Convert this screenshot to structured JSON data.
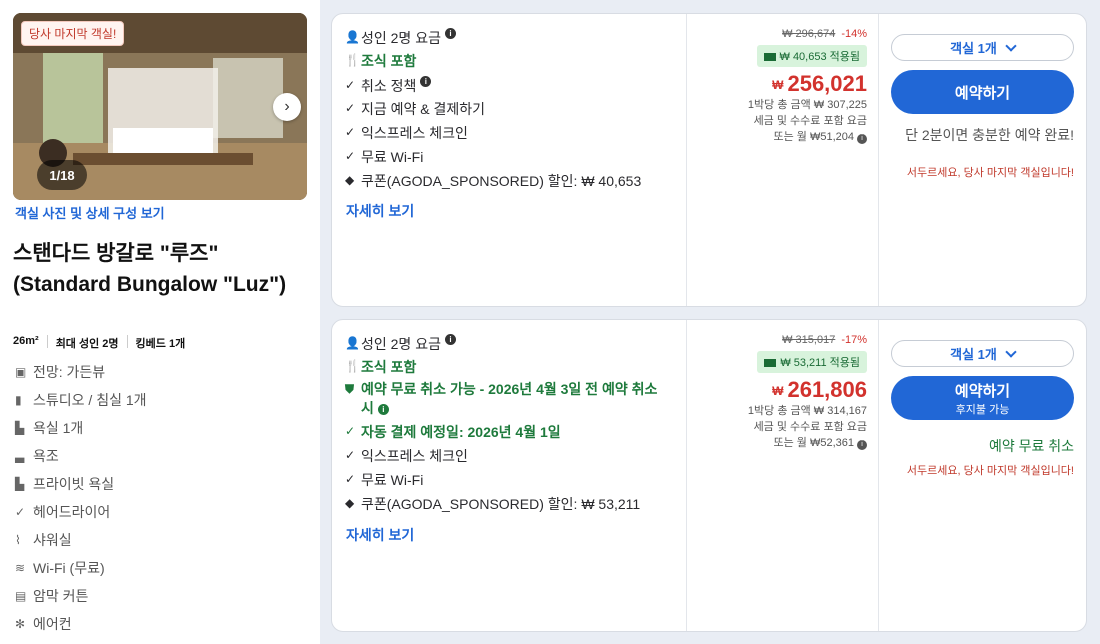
{
  "room": {
    "last_room_tag": "당사 마지막 객실!",
    "photo_counter": "1/18",
    "photos_link": "객실 사진 및 상세 구성 보기",
    "title": "스탠다드 방갈로 \"루즈\" (Standard Bungalow \"Luz\")",
    "specs": [
      "26m²",
      "최대 성인 2명",
      "킹베드 1개"
    ],
    "amenities": [
      {
        "icon": "view-icon",
        "label": "전망: 가든뷰"
      },
      {
        "icon": "studio-icon",
        "label": "스튜디오 / 침실 1개"
      },
      {
        "icon": "bathroom-icon",
        "label": "욕실 1개"
      },
      {
        "icon": "bathtub-icon",
        "label": "욕조"
      },
      {
        "icon": "private-bath-icon",
        "label": "프라이빗 욕실"
      },
      {
        "icon": "check-icon",
        "label": "헤어드라이어"
      },
      {
        "icon": "shower-icon",
        "label": "샤워실"
      },
      {
        "icon": "wifi-icon",
        "label": "Wi-Fi (무료)"
      },
      {
        "icon": "curtain-icon",
        "label": "암막 커튼"
      },
      {
        "icon": "aircon-icon",
        "label": "에어컨"
      }
    ]
  },
  "offers": [
    {
      "guests": "성인 2명 요금",
      "features": [
        {
          "icon": "person-icon",
          "text": "성인 2명 요금",
          "green": false,
          "info": true
        },
        {
          "icon": "breakfast-icon",
          "text": "조식 포함",
          "green": true,
          "info": false
        },
        {
          "icon": "check-icon",
          "text": "취소 정책",
          "green": false,
          "info": true
        },
        {
          "icon": "check-icon",
          "text": "지금 예약 & 결제하기",
          "green": false,
          "info": false
        },
        {
          "icon": "check-icon",
          "text": "익스프레스 체크인",
          "green": false,
          "info": false
        },
        {
          "icon": "check-icon",
          "text": "무료 Wi-Fi",
          "green": false,
          "info": false
        },
        {
          "icon": "coupon-icon",
          "text": "쿠폰(AGODA_SPONSORED) 할인: ₩ 40,653",
          "green": false,
          "info": false
        }
      ],
      "details_link": "자세히 보기",
      "original_price": "₩ 296,674",
      "discount": "-14%",
      "savings": "₩ 40,653 적용됨",
      "currency": "₩",
      "price": "256,021",
      "notes": [
        "1박당 총 금액 ₩ 307,225",
        "세금 및 수수료 포함 요금",
        "또는 월 ₩51,204"
      ],
      "qty": "객실 1개",
      "book_label": "예약하기",
      "book_sub": "",
      "urgency": "단 2분이면 충분한 예약 완료!",
      "free_cancel": "",
      "hurry": "서두르세요, 당사 마지막 객실입니다!"
    },
    {
      "guests": "성인 2명 요금",
      "features": [
        {
          "icon": "person-icon",
          "text": "성인 2명 요금",
          "green": false,
          "info": true
        },
        {
          "icon": "breakfast-icon",
          "text": "조식 포함",
          "green": true,
          "info": false
        },
        {
          "icon": "shield-icon",
          "text": "예약 무료 취소 가능 - 2026년 4월 3일 전 예약 취소 시",
          "green": true,
          "info": true
        },
        {
          "icon": "check-icon",
          "text": "자동 결제 예정일: 2026년 4월 1일",
          "green": true,
          "info": false
        },
        {
          "icon": "check-icon",
          "text": "익스프레스 체크인",
          "green": false,
          "info": false
        },
        {
          "icon": "check-icon",
          "text": "무료 Wi-Fi",
          "green": false,
          "info": false
        },
        {
          "icon": "coupon-icon",
          "text": "쿠폰(AGODA_SPONSORED) 할인: ₩ 53,211",
          "green": false,
          "info": false
        }
      ],
      "details_link": "자세히 보기",
      "original_price": "₩ 315,017",
      "discount": "-17%",
      "savings": "₩ 53,211 적용됨",
      "currency": "₩",
      "price": "261,806",
      "notes": [
        "1박당 총 금액 ₩ 314,167",
        "세금 및 수수료 포함 요금",
        "또는 월 ₩52,361"
      ],
      "qty": "객실 1개",
      "book_label": "예약하기",
      "book_sub": "후지불 가능",
      "urgency": "",
      "free_cancel": "예약 무료 취소",
      "hurry": "서두르세요, 당사 마지막 객실입니다!"
    }
  ]
}
